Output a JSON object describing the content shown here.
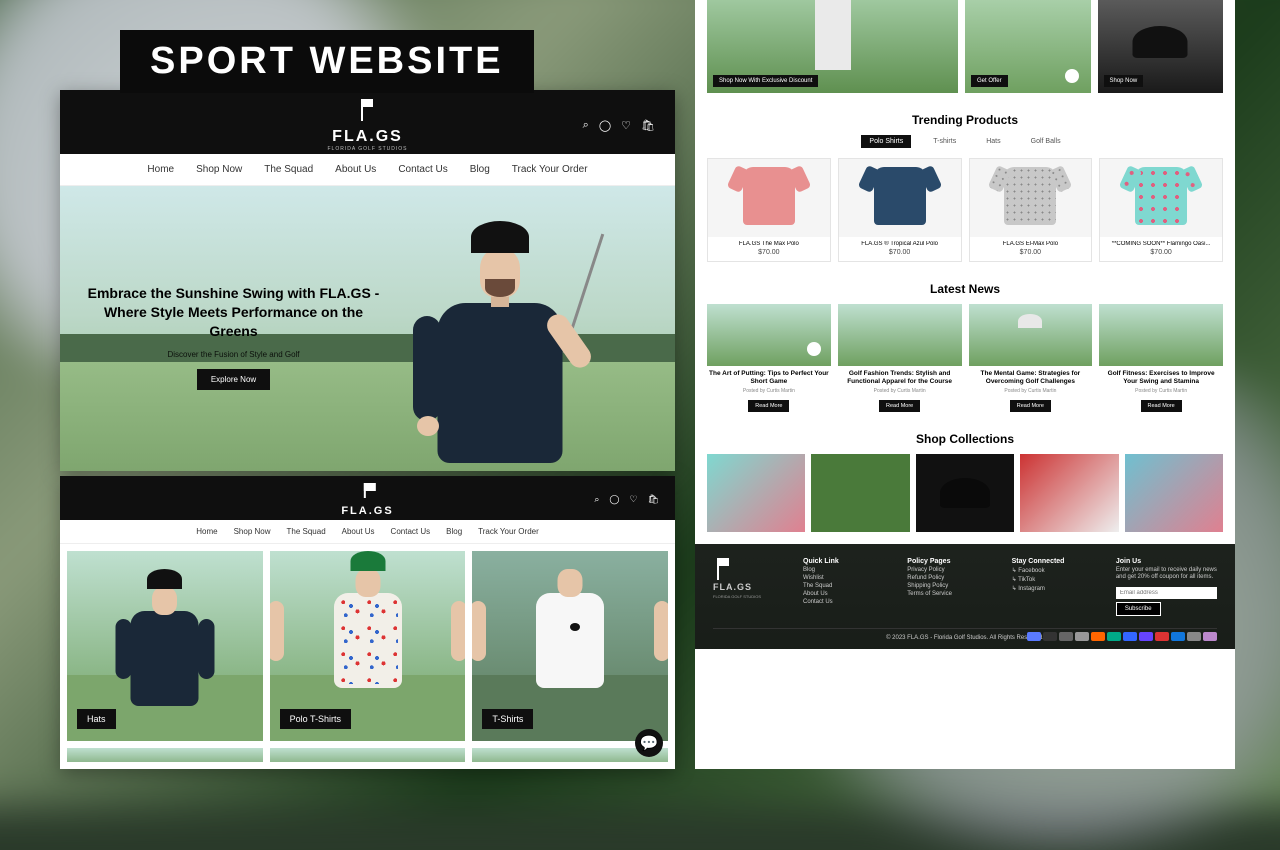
{
  "banner": "SPORT WEBSITE",
  "brand": {
    "name": "FLA.GS",
    "tagline": "FLORIDA GOLF STUDIOS"
  },
  "header_icons": {
    "search": "⌕",
    "account": "◯",
    "wishlist": "♡",
    "cart": "🛍"
  },
  "nav": [
    "Home",
    "Shop Now",
    "The Squad",
    "About Us",
    "Contact Us",
    "Blog",
    "Track Your Order"
  ],
  "hero": {
    "title": "Embrace the Sunshine Swing with FLA.GS - Where Style Meets Performance on the Greens",
    "subtitle": "Discover the Fusion of Style and Golf",
    "cta": "Explore Now"
  },
  "categories": [
    {
      "label": "Hats"
    },
    {
      "label": "Polo T-Shirts"
    },
    {
      "label": "T-Shirts"
    }
  ],
  "promos": [
    {
      "label": "Shop Now With Exclusive Discount"
    },
    {
      "label": "Get Offer"
    },
    {
      "label": "Shop Now"
    }
  ],
  "sections": {
    "trending": "Trending Products",
    "latest_news": "Latest News",
    "shop_collections": "Shop Collections"
  },
  "tabs": [
    "Polo Shirts",
    "T-shirts",
    "Hats",
    "Golf Balls"
  ],
  "products": [
    {
      "name": "FLA.GS The Max Polo",
      "price": "$70.00"
    },
    {
      "name": "FLA.GS ® Tropical Azul Polo",
      "price": "$70.00"
    },
    {
      "name": "FLA.GS El-Max Polo",
      "price": "$70.00"
    },
    {
      "name": "**COMING SOON** Flamingo Oasi...",
      "price": "$70.00"
    }
  ],
  "news": [
    {
      "title": "The Art of Putting: Tips to Perfect Your Short Game",
      "by": "Posted by Curtis Martin",
      "btn": "Read More"
    },
    {
      "title": "Golf Fashion Trends: Stylish and Functional Apparel for the Course",
      "by": "Posted by Curtis Martin",
      "btn": "Read More"
    },
    {
      "title": "The Mental Game: Strategies for Overcoming Golf Challenges",
      "by": "Posted by Curtis Martin",
      "btn": "Read More"
    },
    {
      "title": "Golf Fitness: Exercises to Improve Your Swing and Stamina",
      "by": "Posted by Curtis Martin",
      "btn": "Read More"
    }
  ],
  "footer": {
    "quick_link_title": "Quick Link",
    "quick_links": [
      "Blog",
      "Wishlist",
      "The Squad",
      "About Us",
      "Contact Us"
    ],
    "policy_title": "Policy Pages",
    "policies": [
      "Privacy Policy",
      "Refund Policy",
      "Shipping Policy",
      "Terms of Service"
    ],
    "stay_title": "Stay Connected",
    "socials": [
      "↳ Facebook",
      "↳ TikTok",
      "↳ Instagram"
    ],
    "join_title": "Join Us",
    "join_blurb": "Enter your email to receive daily news and get 20% off coupon for all items.",
    "email_placeholder": "Email address",
    "subscribe": "Subscribe",
    "copyright": "© 2023 FLA.GS - Florida Golf Studios. All Rights Reserved."
  },
  "pay_colors": [
    "#5a7aff",
    "#333",
    "#666",
    "#999",
    "#f60",
    "#0a8",
    "#36f",
    "#64f",
    "#d33",
    "#17d",
    "#888",
    "#b8c"
  ]
}
